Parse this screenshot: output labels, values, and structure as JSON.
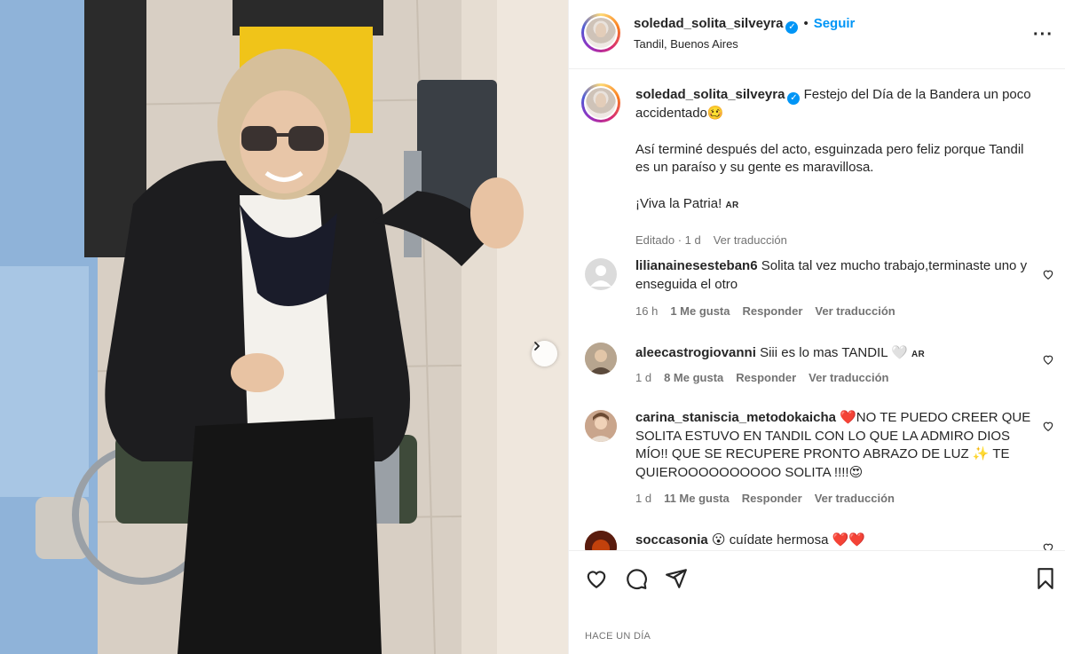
{
  "post": {
    "username": "soledad_solita_silveyra",
    "follow_label": "Seguir",
    "location": "Tandil, Buenos Aires",
    "caption_line1": "Festejo del Día de la Bandera un poco accidentado🥴",
    "caption_line2": "Así terminé después del acto, esguinzada pero feliz porque Tandil es un paraíso y su gente es maravillosa.",
    "caption_line3": "¡Viva la Patria!",
    "caption_flag": "AR",
    "caption_edited": "Editado · 1 d",
    "see_translation": "Ver traducción",
    "timestamp": "HACE UN DÍA"
  },
  "comments": [
    {
      "user": "lilianainesesteban6",
      "text": "Solita tal vez mucho trabajo,terminaste uno y enseguida el otro",
      "age": "16 h",
      "likes": "1 Me gusta",
      "reply": "Responder",
      "translate": "Ver traducción"
    },
    {
      "user": "aleecastrogiovanni",
      "text": "Siii es lo mas TANDIL 🤍",
      "flag": "AR",
      "age": "1 d",
      "likes": "8 Me gusta",
      "reply": "Responder",
      "translate": "Ver traducción"
    },
    {
      "user": "carina_staniscia_metodokaicha",
      "text": "❤️NO TE PUEDO CREER QUE SOLITA ESTUVO EN TANDIL CON LO QUE LA ADMIRO DIOS MÍO!! QUE SE RECUPERE PRONTO ABRAZO DE LUZ ✨ TE QUIEROOOOOOOOOO SOLITA !!!!😍",
      "age": "1 d",
      "likes": "11 Me gusta",
      "reply": "Responder",
      "translate": "Ver traducción"
    },
    {
      "user": "soccasonia",
      "text": "😮 cuídate hermosa ❤️❤️"
    }
  ],
  "icons": {
    "more": "more-options-icon",
    "like": "heart-icon",
    "comment": "comment-icon",
    "share": "share-icon",
    "save": "bookmark-icon",
    "next": "chevron-right-icon",
    "verified": "verified-badge-icon"
  },
  "colors": {
    "accent": "#0095f6",
    "text": "#262626",
    "muted": "#737373",
    "border": "#efefef"
  }
}
